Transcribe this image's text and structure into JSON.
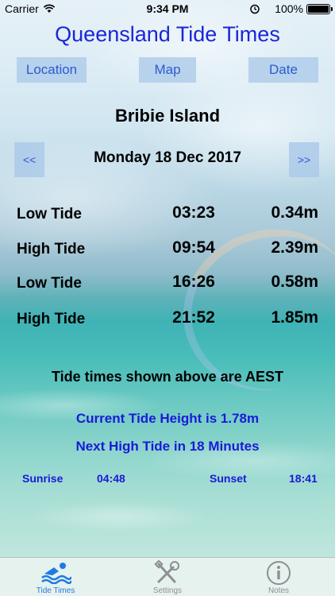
{
  "status_bar": {
    "carrier": "Carrier",
    "time": "9:34 PM",
    "battery_pct": "100%"
  },
  "app": {
    "title": "Queensland Tide Times"
  },
  "toolbar": {
    "location_label": "Location",
    "map_label": "Map",
    "date_label": "Date"
  },
  "location": {
    "name": "Bribie Island"
  },
  "date_nav": {
    "prev_label": "<<",
    "date": "Monday 18 Dec 2017",
    "next_label": ">>"
  },
  "tides": [
    {
      "type": "Low Tide",
      "time": "03:23",
      "height": "0.34m"
    },
    {
      "type": "High Tide",
      "time": "09:54",
      "height": "2.39m"
    },
    {
      "type": "Low Tide",
      "time": "16:26",
      "height": "0.58m"
    },
    {
      "type": "High Tide",
      "time": "21:52",
      "height": "1.85m"
    }
  ],
  "info": {
    "tz_note": "Tide times shown above are AEST",
    "current_height": "Current Tide Height is 1.78m",
    "next_tide": "Next High Tide in 18 Minutes",
    "sunrise_label": "Sunrise",
    "sunrise_time": "04:48",
    "sunset_label": "Sunset",
    "sunset_time": "18:41"
  },
  "tab_bar": {
    "tabs": [
      {
        "label": "Tide Times",
        "icon": "swimmer-icon",
        "selected": true
      },
      {
        "label": "Settings",
        "icon": "tools-icon",
        "selected": false
      },
      {
        "label": "Notes",
        "icon": "info-icon",
        "selected": false
      }
    ]
  },
  "colors": {
    "title_blue": "#1a26d9",
    "info_blue": "#1a1ad9",
    "button_bg": "#aac8e8",
    "tab_selected": "#1f7be0",
    "tab_unselected": "#8e8e93"
  }
}
